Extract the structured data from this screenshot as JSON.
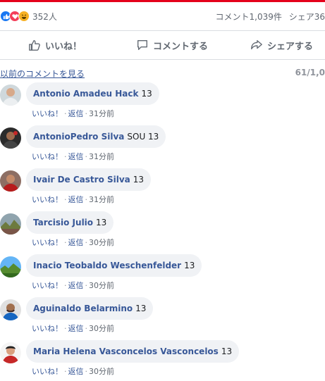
{
  "reactions": {
    "count": "352人",
    "types": [
      "like-icon",
      "love-icon",
      "haha-icon"
    ]
  },
  "stats": {
    "comments": "コメント1,039件",
    "shares": "シェア36"
  },
  "actions": {
    "like": "いいね！",
    "comment": "コメントする",
    "share": "シェアする"
  },
  "prev": {
    "link": "以前のコメントを見る",
    "count": "61/1,0"
  },
  "comments": [
    {
      "author": "Antonio Amadeu Hack",
      "text": "13",
      "like": "いいね！",
      "reply": "返信",
      "time": "31分前"
    },
    {
      "author": "AntonioPedro Silva",
      "text": "SOU 13",
      "like": "いいね！",
      "reply": "返信",
      "time": "31分前"
    },
    {
      "author": "Ivair De Castro Silva",
      "text": "13",
      "like": "いいね！",
      "reply": "返信",
      "time": "31分前"
    },
    {
      "author": "Tarcisio Julio",
      "text": "13",
      "like": "いいね！",
      "reply": "返信",
      "time": "30分前"
    },
    {
      "author": "Inacio Teobaldo Weschenfelder",
      "text": "13",
      "like": "いいね！",
      "reply": "返信",
      "time": "30分前"
    },
    {
      "author": "Aguinaldo Belarmino",
      "text": "13",
      "like": "いいね！",
      "reply": "返信",
      "time": "30分前"
    },
    {
      "author": "Maria Helena Vasconcelos Vasconcelos",
      "text": "13",
      "like": "いいね！",
      "reply": "返信",
      "time": "30分前"
    }
  ],
  "colors": {
    "accent": "#e4001b",
    "link": "#385898",
    "bubble": "#f0f2f5"
  }
}
